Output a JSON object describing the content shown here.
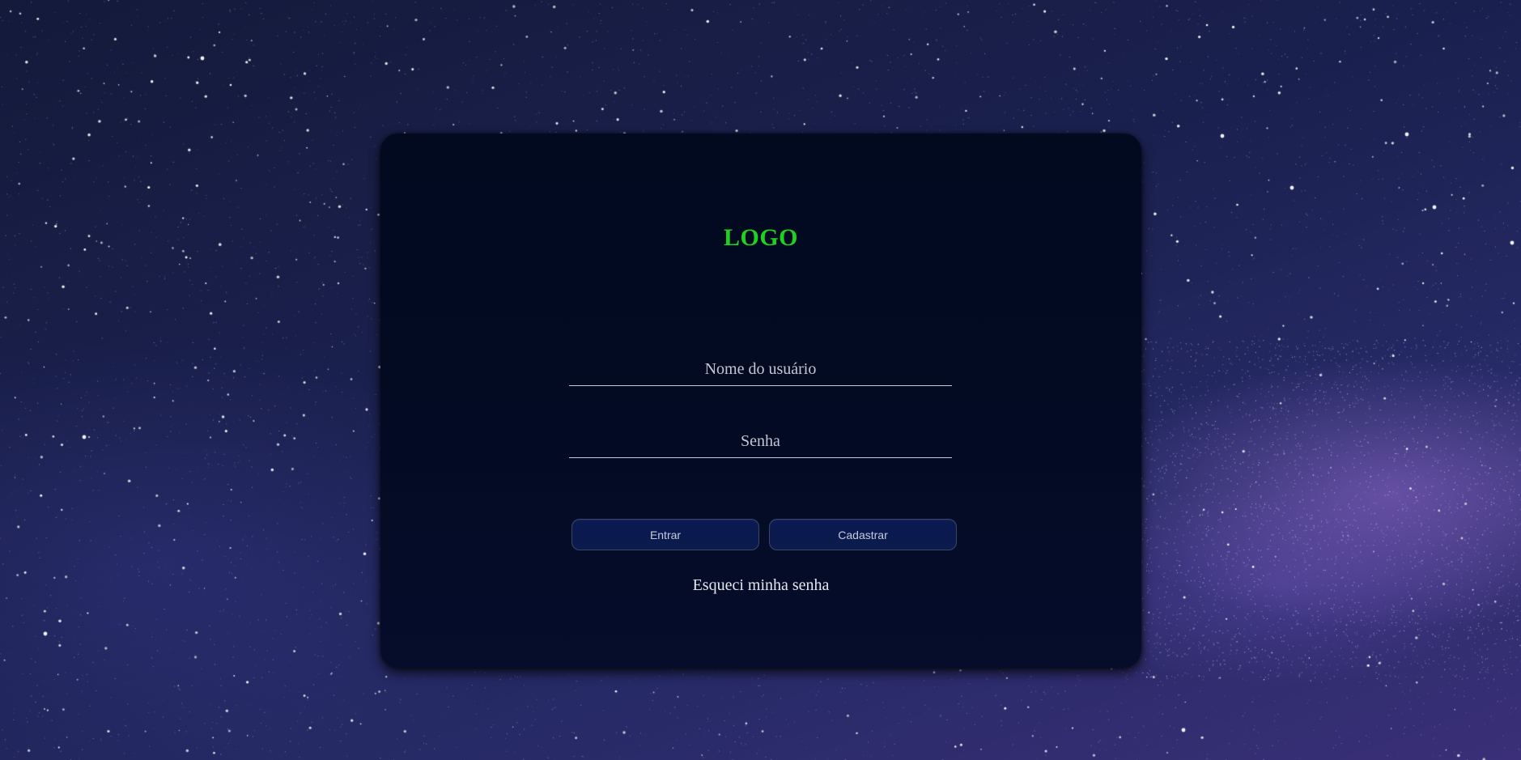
{
  "background": {
    "description_color": "#1b2150",
    "accent_color": "#966ed2"
  },
  "card": {
    "logo_text": "LOGO",
    "logo_color": "#1fd21f",
    "username_placeholder": "Nome do usuário",
    "username_value": "",
    "password_placeholder": "Senha",
    "password_value": "",
    "enter_label": "Entrar",
    "register_label": "Cadastrar",
    "forgot_label": "Esqueci minha senha"
  }
}
